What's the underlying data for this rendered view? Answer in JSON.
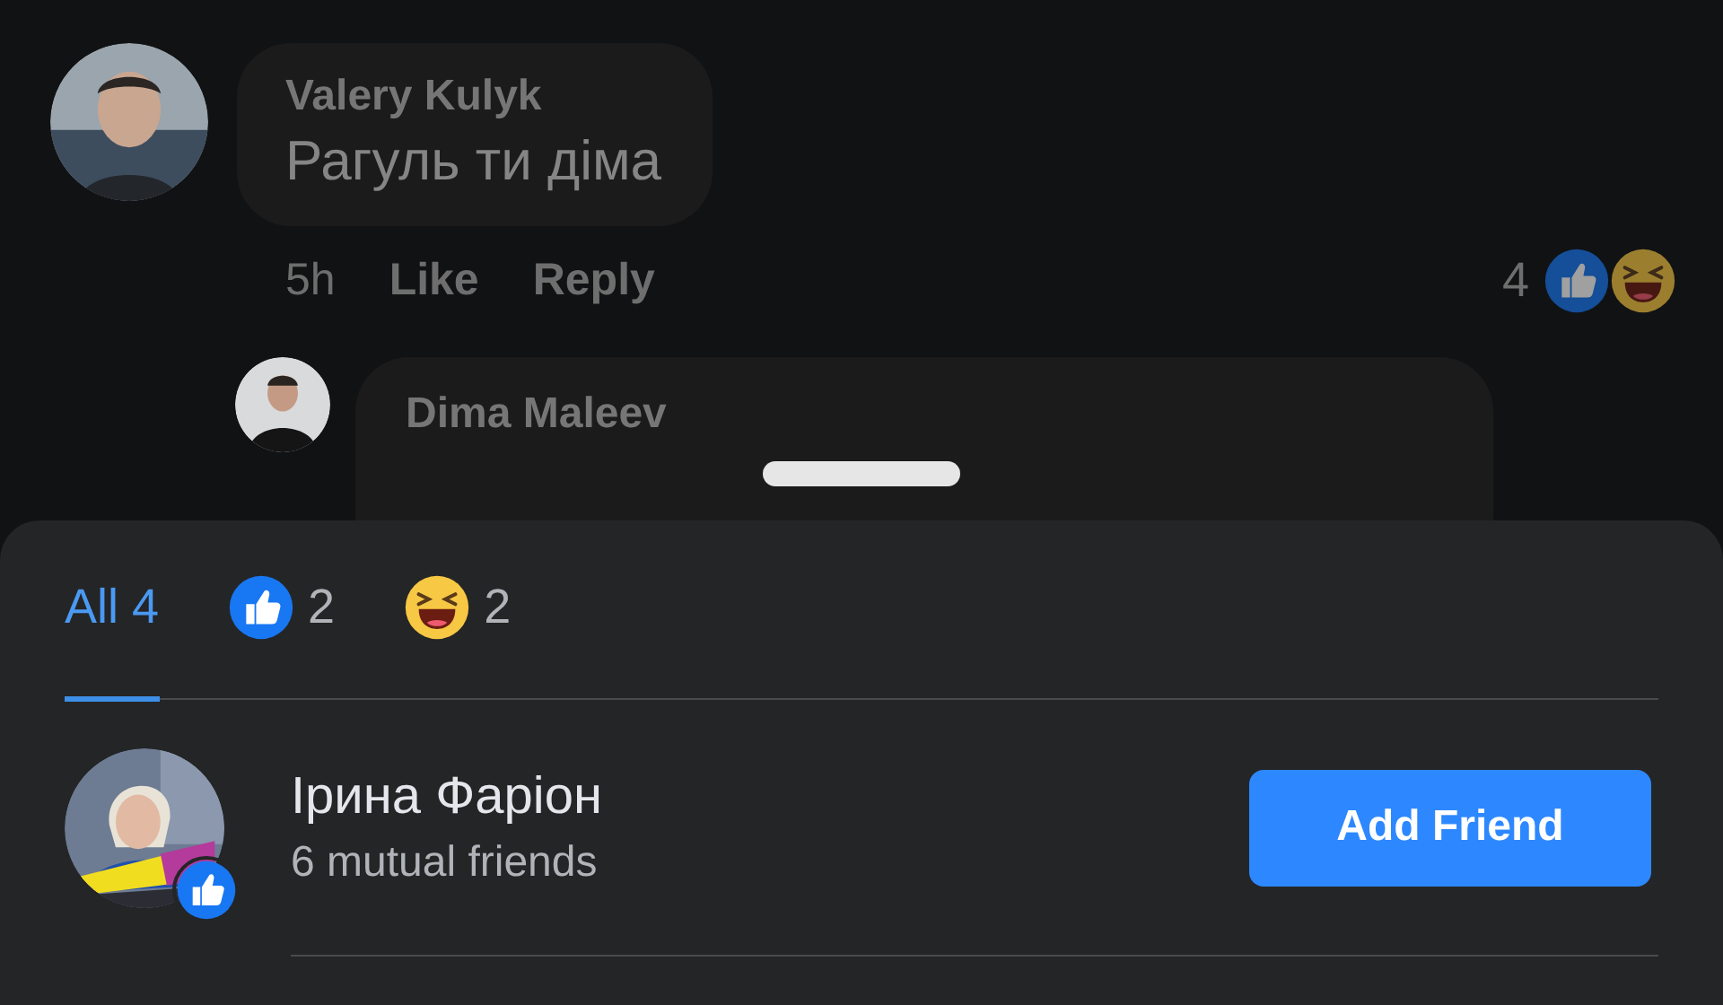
{
  "comment": {
    "author": "Valery Kulyk",
    "text": "Рагуль ти діма",
    "time": "5h",
    "actions": [
      "Like",
      "Reply"
    ],
    "reaction_count": "4",
    "reactions": [
      {
        "kind": "like"
      },
      {
        "kind": "haha"
      }
    ]
  },
  "reply": {
    "author": "Dima Maleev"
  },
  "sheet": {
    "tabs": [
      {
        "kind": "all",
        "label": "All 4",
        "selected": true
      },
      {
        "kind": "like",
        "label": "2",
        "selected": false
      },
      {
        "kind": "haha",
        "label": "2",
        "selected": false
      }
    ],
    "people": [
      {
        "name": "Ірина Фаріон",
        "subtitle": "6 mutual friends",
        "badge": {
          "kind": "like"
        },
        "button": "Add Friend"
      }
    ]
  }
}
